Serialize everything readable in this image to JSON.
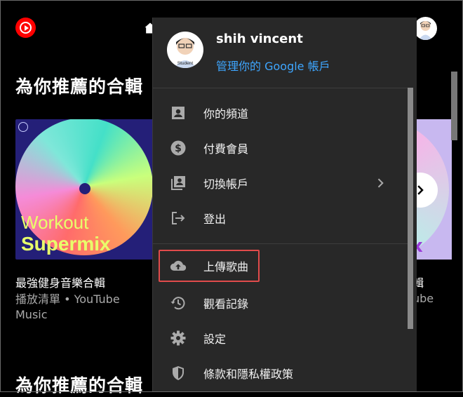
{
  "background": {
    "section_title_1": "為你推薦的合輯",
    "section_title_2": "為你推薦的合輯",
    "card_1": {
      "art_line_1": "Workout",
      "art_line_2": "Supermix",
      "title": "最強健身音樂合輯",
      "subtitle": "播放清單 • YouTube Music"
    },
    "card_2": {
      "art_fragment": "x",
      "title_fragment": "輯",
      "subtitle_fragment": "ube"
    }
  },
  "account_menu": {
    "name": "shih vincent",
    "manage_link": "管理你的 Google 帳戶",
    "avatar_caption": "Student",
    "items": [
      {
        "label": "你的頻道",
        "icon": "account-box-icon"
      },
      {
        "label": "付費會員",
        "icon": "dollar-circle-icon"
      },
      {
        "label": "切換帳戶",
        "icon": "switch-account-icon"
      },
      {
        "label": "登出",
        "icon": "sign-out-icon"
      },
      {
        "label": "上傳歌曲",
        "icon": "cloud-upload-icon"
      },
      {
        "label": "觀看記錄",
        "icon": "history-icon"
      },
      {
        "label": "設定",
        "icon": "gear-icon"
      },
      {
        "label": "條款和隱私權政策",
        "icon": "shield-icon"
      }
    ],
    "highlight_color": "#e14b4b"
  },
  "colors": {
    "brand_red": "#ff0000",
    "link_blue": "#3ea6ff",
    "menu_bg": "#282828"
  }
}
